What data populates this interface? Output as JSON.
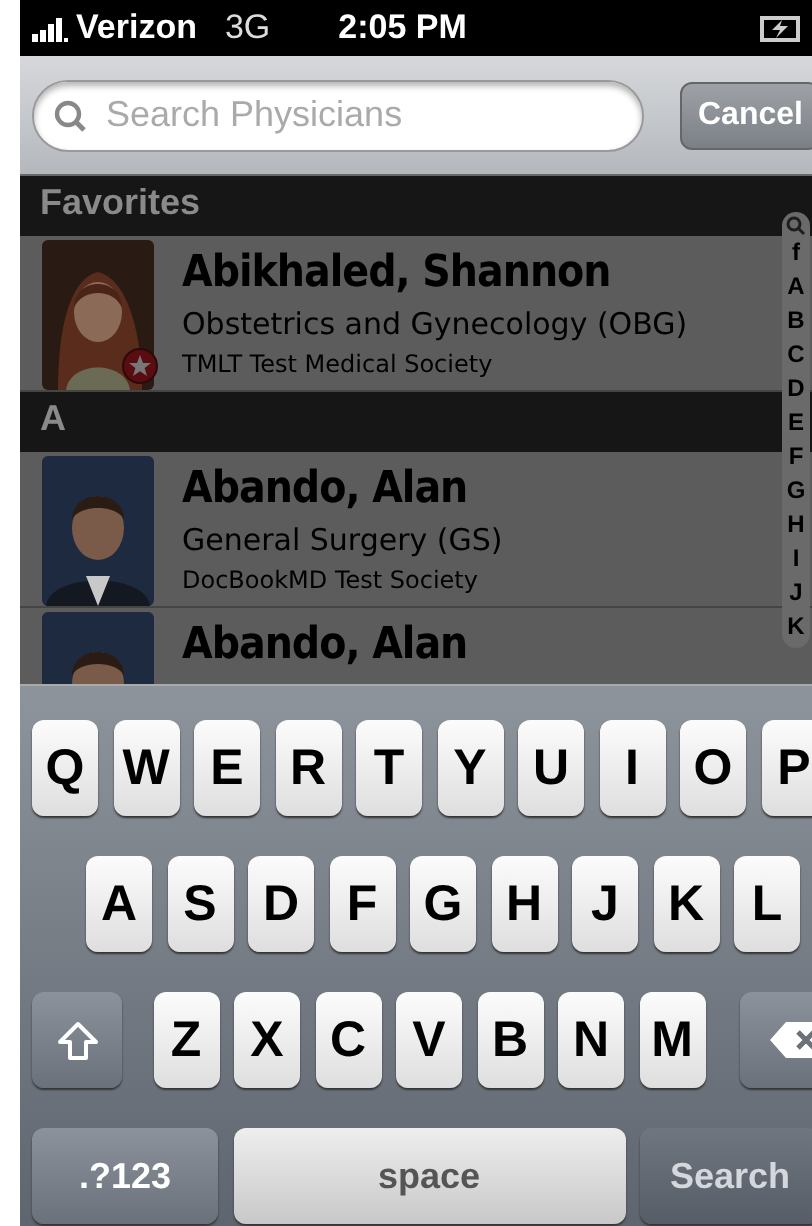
{
  "status_bar": {
    "carrier": "Verizon",
    "network": "3G",
    "time": "2:05 PM"
  },
  "search": {
    "placeholder": "Search Physicians",
    "cancel": "Cancel"
  },
  "sections": [
    {
      "header": "Favorites",
      "physicians": [
        {
          "name": "Abikhaled, Shannon",
          "specialty": "Obstetrics and Gynecology (OBG)",
          "society": "TMLT Test  Medical Society",
          "favorite": true
        }
      ]
    },
    {
      "header": "A",
      "physicians": [
        {
          "name": "Abando, Alan",
          "specialty": "General Surgery (GS)",
          "society": "DocBookMD Test Society",
          "favorite": false
        },
        {
          "name": "Abando, Alan",
          "favorite": false
        }
      ]
    }
  ],
  "index": [
    "f",
    "A",
    "B",
    "C",
    "D",
    "E",
    "F",
    "G",
    "H",
    "I",
    "J",
    "K"
  ],
  "keyboard": {
    "rows": [
      {
        "keys": [
          {
            "kind": "letter",
            "label": "Q"
          },
          {
            "kind": "letter",
            "label": "W"
          },
          {
            "kind": "letter",
            "label": "E"
          },
          {
            "kind": "letter",
            "label": "R"
          },
          {
            "kind": "letter",
            "label": "T"
          },
          {
            "kind": "letter",
            "label": "Y"
          },
          {
            "kind": "letter",
            "label": "U"
          },
          {
            "kind": "letter",
            "label": "I"
          },
          {
            "kind": "letter",
            "label": "O"
          },
          {
            "kind": "letter",
            "label": "P"
          }
        ]
      },
      {
        "keys": [
          {
            "kind": "letter",
            "label": "A"
          },
          {
            "kind": "letter",
            "label": "S"
          },
          {
            "kind": "letter",
            "label": "D"
          },
          {
            "kind": "letter",
            "label": "F"
          },
          {
            "kind": "letter",
            "label": "G"
          },
          {
            "kind": "letter",
            "label": "H"
          },
          {
            "kind": "letter",
            "label": "J"
          },
          {
            "kind": "letter",
            "label": "K"
          },
          {
            "kind": "letter",
            "label": "L"
          }
        ]
      },
      {
        "keys": [
          {
            "kind": "shift"
          },
          {
            "kind": "letter",
            "label": "Z"
          },
          {
            "kind": "letter",
            "label": "X"
          },
          {
            "kind": "letter",
            "label": "C"
          },
          {
            "kind": "letter",
            "label": "V"
          },
          {
            "kind": "letter",
            "label": "B"
          },
          {
            "kind": "letter",
            "label": "N"
          },
          {
            "kind": "letter",
            "label": "M"
          },
          {
            "kind": "delete"
          }
        ]
      },
      {
        "keys": [
          {
            "kind": "mode",
            "label": ".?123"
          },
          {
            "kind": "space",
            "label": "space"
          },
          {
            "kind": "return",
            "label": "Search",
            "disabled": true
          }
        ]
      }
    ]
  }
}
